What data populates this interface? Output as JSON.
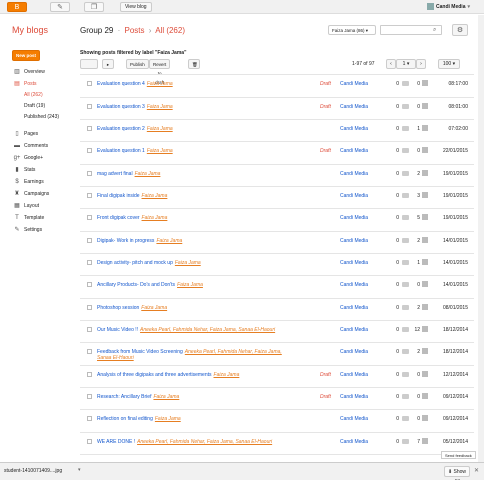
{
  "topbar": {
    "view_blog": "View blog",
    "user": "Candi Media",
    "icons": [
      "blogger-logo-icon",
      "pencil-icon",
      "copy-icon"
    ]
  },
  "header": {
    "my_blogs": "My blogs",
    "blog_name": "Group 29",
    "section": "Posts",
    "filter": "All (262)",
    "label_filter": "Faiza Jama (86)",
    "search_placeholder": ""
  },
  "sidebar": {
    "new_post": "New post",
    "items": [
      {
        "label": "Overview",
        "icon": "overview-icon"
      },
      {
        "label": "Posts",
        "icon": "posts-icon"
      },
      {
        "label": "Pages",
        "icon": "pages-icon"
      },
      {
        "label": "Comments",
        "icon": "comments-icon"
      },
      {
        "label": "Google+",
        "icon": "googleplus-icon"
      },
      {
        "label": "Stats",
        "icon": "stats-icon"
      },
      {
        "label": "Earnings",
        "icon": "earnings-icon"
      },
      {
        "label": "Campaigns",
        "icon": "campaigns-icon"
      },
      {
        "label": "Layout",
        "icon": "layout-icon"
      },
      {
        "label": "Template",
        "icon": "template-icon"
      },
      {
        "label": "Settings",
        "icon": "settings-icon"
      }
    ],
    "post_filters": [
      "All (262)",
      "Draft (19)",
      "Published (243)"
    ]
  },
  "listing": {
    "showing": "Showing posts filtered by label \"Faiza Jama\"",
    "publish": "Publish",
    "revert": "Revert to draft",
    "range": "1-97 of 97",
    "page": "1",
    "per_page": "100",
    "draft_label": "Draft",
    "author": "Candi Media"
  },
  "posts": [
    {
      "title": "Evaluation question 4",
      "labels": "Faiza Jama",
      "draft": true,
      "comments": "0",
      "views": "0",
      "date": "08:17:00"
    },
    {
      "title": "Evaluation question 3",
      "labels": "Faiza Jama",
      "draft": true,
      "comments": "0",
      "views": "0",
      "date": "08:01:00"
    },
    {
      "title": "Evaluation question 2",
      "labels": "Faiza Jama",
      "draft": false,
      "comments": "0",
      "views": "1",
      "date": "07:02:00"
    },
    {
      "title": "Evaluation question 1",
      "labels": "Faiza Jama",
      "draft": true,
      "comments": "0",
      "views": "0",
      "date": "22/01/2015"
    },
    {
      "title": "mag advert final",
      "labels": "Faiza Jama",
      "draft": false,
      "comments": "0",
      "views": "2",
      "date": "19/01/2015"
    },
    {
      "title": "Final digipak inside",
      "labels": "Faiza Jama",
      "draft": false,
      "comments": "0",
      "views": "3",
      "date": "19/01/2015"
    },
    {
      "title": "Front digipak cover",
      "labels": "Faiza Jama",
      "draft": false,
      "comments": "0",
      "views": "5",
      "date": "19/01/2015"
    },
    {
      "title": "Digipak- Work in progress",
      "labels": "Faiza Jama",
      "draft": false,
      "comments": "0",
      "views": "2",
      "date": "14/01/2015"
    },
    {
      "title": "Design activity- pitch and mock up",
      "labels": "Faiza Jama",
      "draft": false,
      "comments": "0",
      "views": "1",
      "date": "14/01/2015"
    },
    {
      "title": "Ancillary Products- Do's and Don'ts",
      "labels": "Faiza Jama",
      "draft": false,
      "comments": "0",
      "views": "0",
      "date": "14/01/2015"
    },
    {
      "title": "Photoshop session",
      "labels": "Faiza Jama",
      "draft": false,
      "comments": "0",
      "views": "2",
      "date": "08/01/2015"
    },
    {
      "title": "Our Music Video !!",
      "labels": "Aneeka Pearl, Fahmida Nehar, Faiza Jama, Sanaa El-Haouri",
      "draft": false,
      "comments": "0",
      "views": "12",
      "date": "18/12/2014"
    },
    {
      "title": "Feedback from Music Video Screening",
      "labels": "Aneeka Pearl, Fahmida Nehar, Faiza Jama,",
      "labels2": "Sanaa El-Haouri",
      "draft": false,
      "comments": "0",
      "views": "2",
      "date": "18/12/2014"
    },
    {
      "title": "Analysis of three digipaks and three advertisements",
      "labels": "Faiza Jama",
      "draft": true,
      "comments": "0",
      "views": "0",
      "date": "12/12/2014"
    },
    {
      "title": "Research: Ancillary Brief",
      "labels": "Faiza Jama",
      "draft": true,
      "comments": "0",
      "views": "0",
      "date": "09/12/2014"
    },
    {
      "title": "Reflection on final editing",
      "labels": "Faiza Jama",
      "draft": false,
      "comments": "0",
      "views": "0",
      "date": "09/12/2014"
    },
    {
      "title": "WE ARE DONE !",
      "labels": "Aneeka Pearl, Fahmida Nehar, Faiza Jama, Sanaa El-Haouri",
      "draft": false,
      "comments": "0",
      "views": "7",
      "date": "05/12/2014"
    }
  ],
  "feedback": "Send feedback",
  "download": {
    "file": "student-1410071409....jpg",
    "show_all": "Show All"
  }
}
